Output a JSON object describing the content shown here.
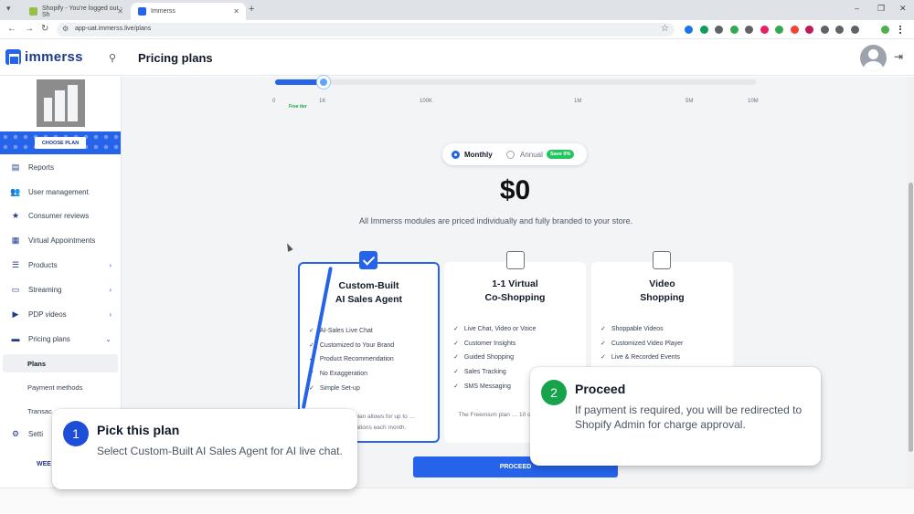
{
  "browser": {
    "tabs": [
      {
        "label": "Shopify - You're logged out - Sh",
        "active": false
      },
      {
        "label": "Immerss",
        "active": true
      }
    ],
    "url": "app-uat.immerss.live/plans",
    "extension_colors": [
      "#1a73e8",
      "#0f9d58",
      "#5f6368",
      "#34a853",
      "#5f6368",
      "#e91e63",
      "#34a853",
      "#f44336",
      "#c2185b",
      "#5f6368",
      "#5f6368",
      "#5f6368"
    ]
  },
  "header": {
    "logo_text": "immerss",
    "page_title": "Pricing plans"
  },
  "sidebar": {
    "choose_plan_label": "CHOOSE PLAN",
    "items": [
      {
        "label": "Reports",
        "icon": "reports-icon",
        "glyph": "▤",
        "chevron": ""
      },
      {
        "label": "User management",
        "icon": "users-icon",
        "glyph": "👥",
        "chevron": ""
      },
      {
        "label": "Consumer reviews",
        "icon": "star-icon",
        "glyph": "★",
        "chevron": ""
      },
      {
        "label": "Virtual Appointments",
        "icon": "calendar-icon",
        "glyph": "▦",
        "chevron": ""
      },
      {
        "label": "Products",
        "icon": "list-icon",
        "glyph": "☰",
        "chevron": "›"
      },
      {
        "label": "Streaming",
        "icon": "monitor-icon",
        "glyph": "▭",
        "chevron": "›"
      },
      {
        "label": "PDP videos",
        "icon": "video-icon",
        "glyph": "▶",
        "chevron": "›"
      },
      {
        "label": "Pricing plans",
        "icon": "pricing-icon",
        "glyph": "▬",
        "chevron": "⌄"
      }
    ],
    "sub_items": [
      {
        "label": "Plans",
        "active": true
      },
      {
        "label": "Payment methods",
        "active": false
      },
      {
        "label": "Transac",
        "active": false
      }
    ],
    "settings_label": "Setti",
    "bottom_label": "WEE"
  },
  "slider": {
    "value_fraction": 0.1,
    "ticks": [
      "0",
      "1K",
      "100K",
      "1M",
      "5M",
      "10M"
    ],
    "free_tier_label": "Free tier"
  },
  "billing": {
    "monthly_label": "Monthly",
    "annual_label": "Annual",
    "save_badge": "Save 0%",
    "selected": "monthly"
  },
  "price": {
    "amount": "$0",
    "note": "All Immerss modules are priced individually and fully branded to your store."
  },
  "plans": [
    {
      "title_line1": "Custom-Built",
      "title_line2": "AI Sales Agent",
      "checked": true,
      "features": [
        "AI-Sales Live Chat",
        "Customized to Your Brand",
        "Product Recommendation",
        "No Exaggeration",
        "Simple Set-up"
      ],
      "footer": "Freemium plan allows for up to … conversations each month."
    },
    {
      "title_line1": "1-1 Virtual",
      "title_line2": "Co-Shopping",
      "checked": false,
      "features": [
        "Live Chat, Video or Voice",
        "Customer Insights",
        "Guided Shopping",
        "Sales Tracking",
        "SMS Messaging"
      ],
      "footer": "The Freemium plan … 10 one-on-one int…"
    },
    {
      "title_line1": "Video",
      "title_line2": "Shopping",
      "checked": false,
      "features": [
        "Shoppable Videos",
        "Customized Video Player",
        "Live & Recorded Events"
      ],
      "footer": ""
    }
  ],
  "proceed_label": "PROCEED",
  "callouts": [
    {
      "number": "1",
      "title": "Pick this plan",
      "body": "Select Custom-Built AI Sales Agent for AI live chat.",
      "color": "#1d4ed8"
    },
    {
      "number": "2",
      "title": "Proceed",
      "body": "If payment is required, you will be redirected to Shopify Admin for charge approval.",
      "color": "#16a34a"
    }
  ]
}
